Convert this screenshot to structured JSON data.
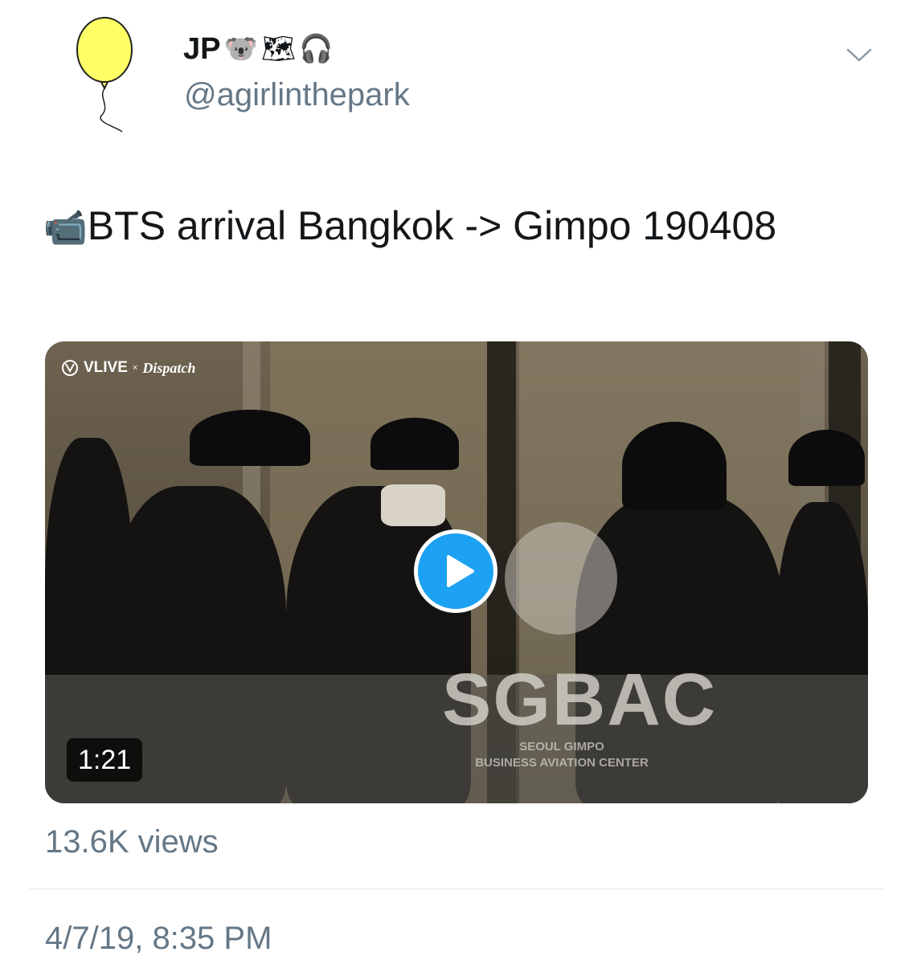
{
  "tweet": {
    "author": {
      "display_name": "JP",
      "name_emojis": [
        "🐨",
        "🗺",
        "🎧"
      ],
      "handle": "@agirlinthepark",
      "avatar_icon": "yellow-balloon-icon",
      "avatar_color": "#ffff66"
    },
    "text_emoji": "📹",
    "text": "BTS arrival Bangkok -> Gimpo 190408",
    "media": {
      "brand_vlive": "VLIVE",
      "brand_separator": "×",
      "brand_partner": "Dispatch",
      "sign_title": "SGBAC",
      "sign_line1": "SEOUL GIMPO",
      "sign_line2": "BUSINESS AVIATION CENTER",
      "duration": "1:21",
      "play_color": "#1da1f2"
    },
    "views": "13.6K views",
    "timestamp": "4/7/19, 8:35 PM"
  }
}
